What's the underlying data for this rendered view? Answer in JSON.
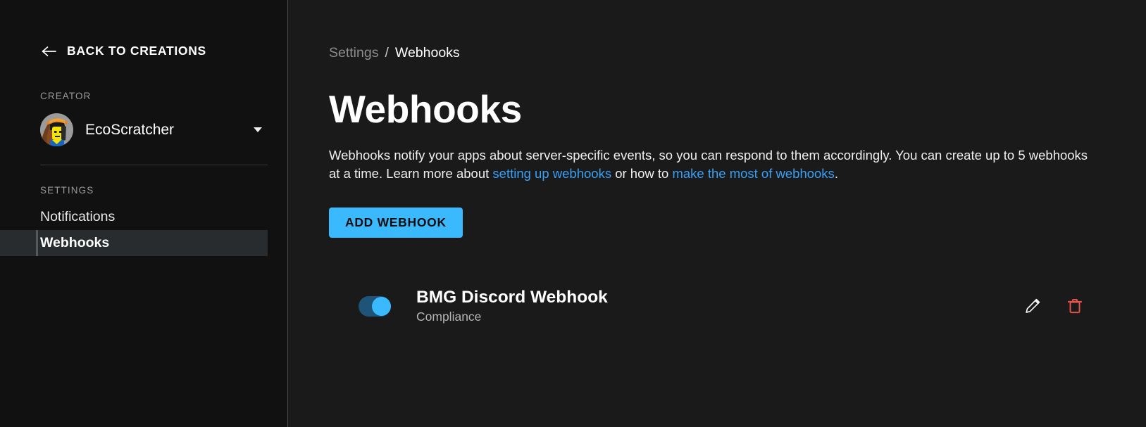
{
  "sidebar": {
    "back_label": "BACK TO CREATIONS",
    "back_icon": "arrow-left-icon",
    "creator_section_label": "CREATOR",
    "creator_name": "EcoScratcher",
    "creator_dropdown_icon": "chevron-down-icon",
    "settings_section_label": "SETTINGS",
    "nav_items": [
      {
        "label": "Notifications",
        "selected": false
      },
      {
        "label": "Webhooks",
        "selected": true
      }
    ]
  },
  "breadcrumb": {
    "parent": "Settings",
    "separator": "/",
    "current": "Webhooks"
  },
  "main": {
    "title": "Webhooks",
    "description": {
      "part1": "Webhooks notify your apps about server-specific events, so you can respond to them accordingly. You can create up to 5 webhooks at a time. Learn more about ",
      "link1": "setting up webhooks",
      "part2": " or how to ",
      "link2": "make the most of webhooks",
      "part3": "."
    },
    "add_button_label": "ADD WEBHOOK"
  },
  "webhooks": [
    {
      "enabled": true,
      "toggle_state": "on",
      "name": "BMG Discord Webhook",
      "subtitle": "Compliance",
      "edit_icon": "pencil-icon",
      "delete_icon": "trash-icon"
    }
  ],
  "colors": {
    "accent_blue": "#3bb9ff",
    "link_blue": "#3aa0f5",
    "delete_red": "#e8544c",
    "sidebar_bg": "#111111",
    "main_bg": "#1a1a1a",
    "selected_bg": "#282c2e"
  }
}
